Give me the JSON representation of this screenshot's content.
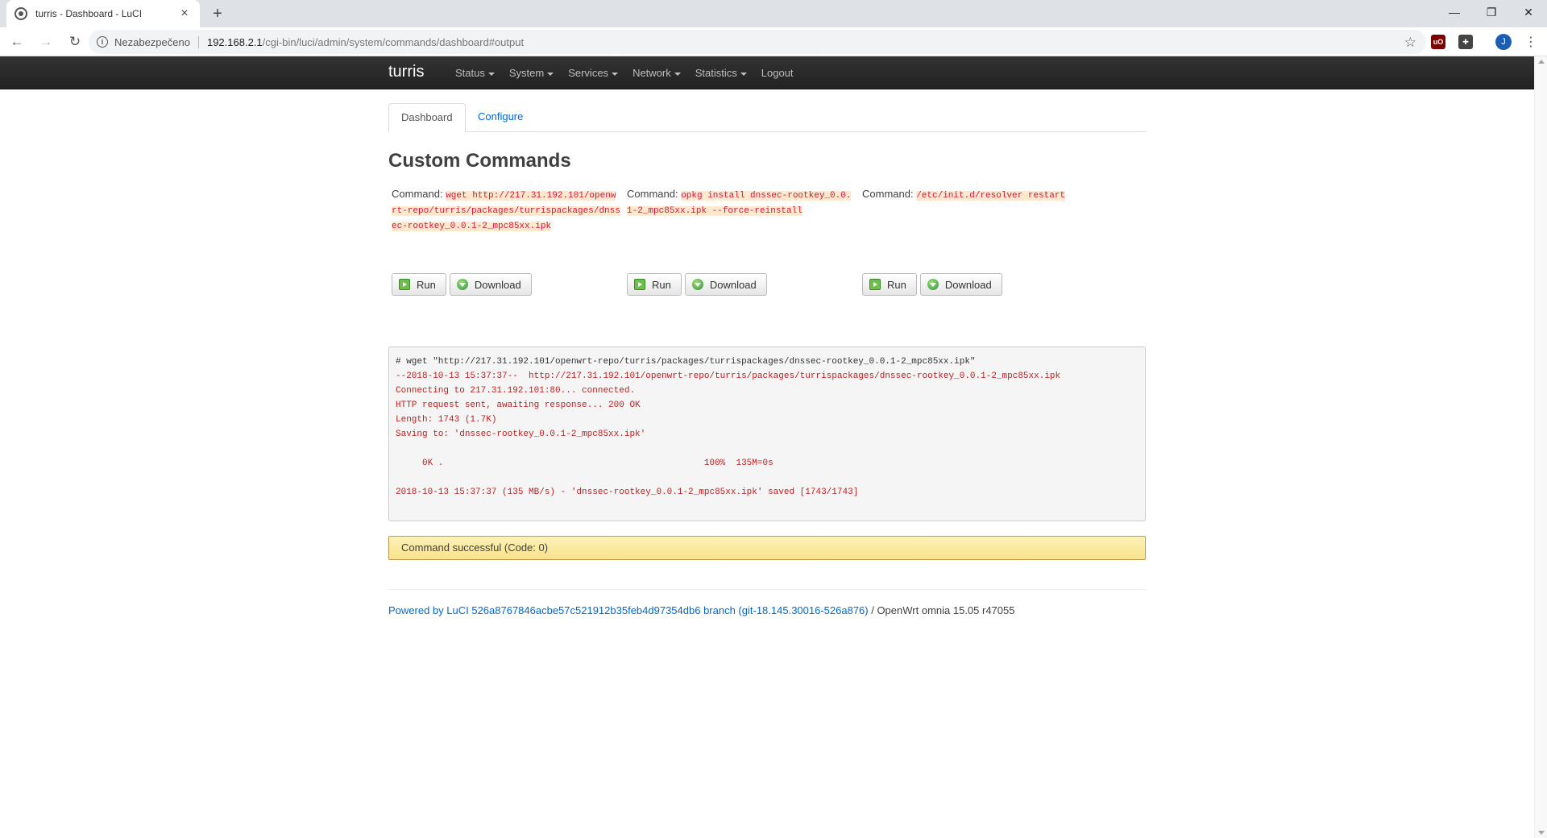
{
  "browser": {
    "tab_title": "turris - Dashboard - LuCI",
    "security_label": "Nezabezpečeno",
    "url_host": "192.168.2.1",
    "url_path": "/cgi-bin/luci/admin/system/commands/dashboard#output",
    "profile_initial": "J"
  },
  "nav": {
    "brand": "turris",
    "items": [
      {
        "label": "Status",
        "dropdown": true
      },
      {
        "label": "System",
        "dropdown": true
      },
      {
        "label": "Services",
        "dropdown": true
      },
      {
        "label": "Network",
        "dropdown": true
      },
      {
        "label": "Statistics",
        "dropdown": true
      },
      {
        "label": "Logout",
        "dropdown": false
      }
    ]
  },
  "tabs": [
    {
      "label": "Dashboard",
      "active": true
    },
    {
      "label": "Configure",
      "active": false
    }
  ],
  "page_title": "Custom Commands",
  "command_prefix": "Command:",
  "commands": [
    {
      "text": "wget http://217.31.192.101/openwrt-repo/turris/packages/turrispackages/dnssec-rootkey_0.0.1-2_mpc85xx.ipk",
      "run_label": "Run",
      "download_label": "Download"
    },
    {
      "text": "opkg install dnssec-rootkey_0.0.1-2_mpc85xx.ipk --force-reinstall",
      "run_label": "Run",
      "download_label": "Download"
    },
    {
      "text": "/etc/init.d/resolver restart",
      "run_label": "Run",
      "download_label": "Download"
    }
  ],
  "output": {
    "command_line": "# wget \"http://217.31.192.101/openwrt-repo/turris/packages/turrispackages/dnssec-rootkey_0.0.1-2_mpc85xx.ipk\"",
    "lines": [
      "--2018-10-13 15:37:37--  http://217.31.192.101/openwrt-repo/turris/packages/turrispackages/dnssec-rootkey_0.0.1-2_mpc85xx.ipk",
      "Connecting to 217.31.192.101:80... connected.",
      "HTTP request sent, awaiting response... 200 OK",
      "Length: 1743 (1.7K)",
      "Saving to: 'dnssec-rootkey_0.0.1-2_mpc85xx.ipk'",
      "",
      "     0K .                                                 100%  135M=0s",
      "",
      "2018-10-13 15:37:37 (135 MB/s) - 'dnssec-rootkey_0.0.1-2_mpc85xx.ipk' saved [1743/1743]"
    ]
  },
  "status_message": "Command successful (Code: 0)",
  "footer": {
    "link_text": "Powered by LuCI 526a8767846acbe57c521912b35feb4d97354db6 branch (git-18.145.30016-526a876)",
    "suffix": " / OpenWrt omnia 15.05 r47055"
  }
}
